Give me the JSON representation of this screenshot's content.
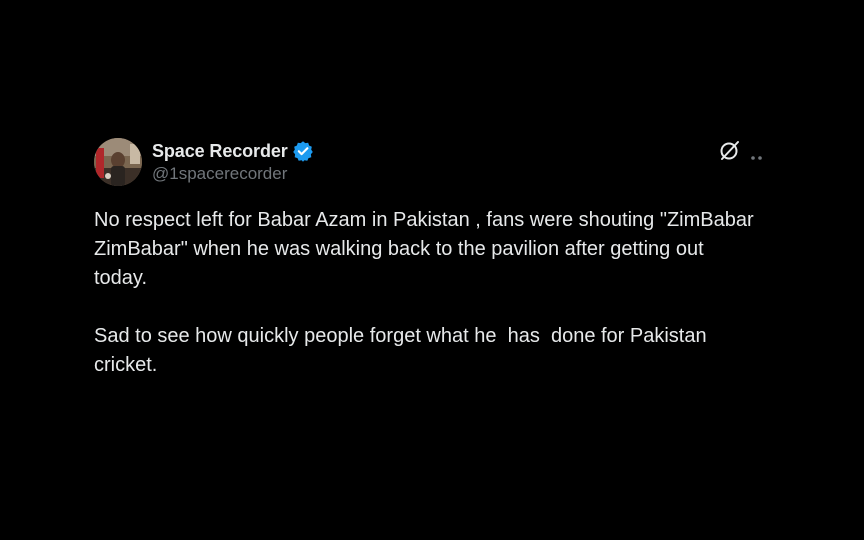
{
  "author": {
    "display_name": "Space Recorder",
    "handle": "@1spacerecorder",
    "verified": true,
    "avatar_icon": "avatar-photo"
  },
  "actions": {
    "grok_icon": "grok-icon",
    "more_icon": "more-options-icon"
  },
  "tweet": {
    "paragraphs": [
      "No respect left for Babar Azam in Pakistan , fans were shouting \"ZimBabar ZimBabar\" when he was walking back to the pavilion after getting out today.",
      "Sad to see how quickly people forget what he  has  done for Pakistan cricket."
    ]
  },
  "colors": {
    "background": "#000000",
    "text": "#e7e9ea",
    "secondary_text": "#71767b",
    "verified_blue": "#1d9bf0"
  }
}
